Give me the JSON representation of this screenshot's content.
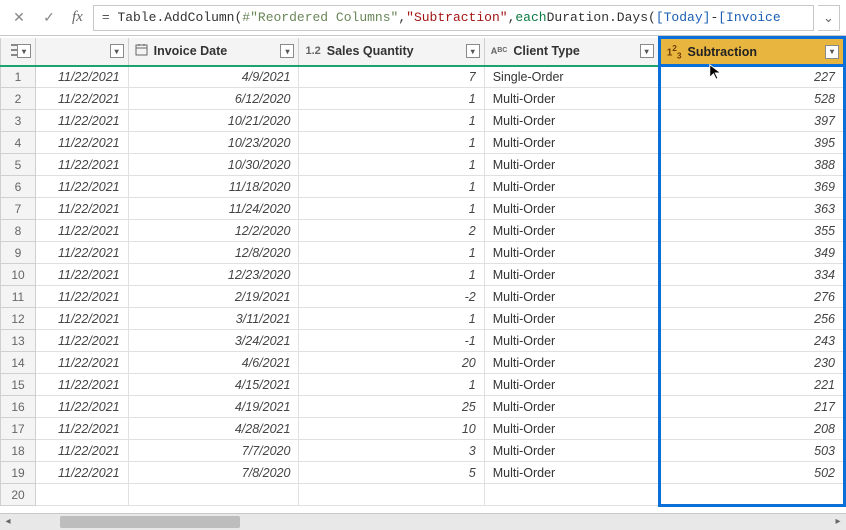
{
  "formula": {
    "eq": "=",
    "expr_parts": {
      "table_addcol": "Table.AddColumn",
      "openp": "(",
      "ref": "#\"Reordered Columns\"",
      "comma1": ", ",
      "str": "\"Subtraction\"",
      "comma2": ", ",
      "each": "each",
      "sp": " ",
      "fn2": "Duration.Days",
      "openp2": "(",
      "today": "[Today]",
      "minus": " - ",
      "inv": "[Invoice"
    }
  },
  "headers": {
    "today_filter": "▾",
    "invdate_label": "Invoice Date",
    "invdate_icon": "📅",
    "qty_icon": "1.2",
    "qty_label": "Sales Quantity",
    "client_icon_a": "A",
    "client_icon_b": "B",
    "client_icon_c": "C",
    "client_label": "Client Type",
    "sub_icon": "1²₃",
    "sub_label": "Subtraction"
  },
  "rows": [
    {
      "idx": "1",
      "today": "11/22/2021",
      "inv": "4/9/2021",
      "qty": "7",
      "client": "Single-Order",
      "sub": "227"
    },
    {
      "idx": "2",
      "today": "11/22/2021",
      "inv": "6/12/2020",
      "qty": "1",
      "client": "Multi-Order",
      "sub": "528"
    },
    {
      "idx": "3",
      "today": "11/22/2021",
      "inv": "10/21/2020",
      "qty": "1",
      "client": "Multi-Order",
      "sub": "397"
    },
    {
      "idx": "4",
      "today": "11/22/2021",
      "inv": "10/23/2020",
      "qty": "1",
      "client": "Multi-Order",
      "sub": "395"
    },
    {
      "idx": "5",
      "today": "11/22/2021",
      "inv": "10/30/2020",
      "qty": "1",
      "client": "Multi-Order",
      "sub": "388"
    },
    {
      "idx": "6",
      "today": "11/22/2021",
      "inv": "11/18/2020",
      "qty": "1",
      "client": "Multi-Order",
      "sub": "369"
    },
    {
      "idx": "7",
      "today": "11/22/2021",
      "inv": "11/24/2020",
      "qty": "1",
      "client": "Multi-Order",
      "sub": "363"
    },
    {
      "idx": "8",
      "today": "11/22/2021",
      "inv": "12/2/2020",
      "qty": "2",
      "client": "Multi-Order",
      "sub": "355"
    },
    {
      "idx": "9",
      "today": "11/22/2021",
      "inv": "12/8/2020",
      "qty": "1",
      "client": "Multi-Order",
      "sub": "349"
    },
    {
      "idx": "10",
      "today": "11/22/2021",
      "inv": "12/23/2020",
      "qty": "1",
      "client": "Multi-Order",
      "sub": "334"
    },
    {
      "idx": "11",
      "today": "11/22/2021",
      "inv": "2/19/2021",
      "qty": "-2",
      "client": "Multi-Order",
      "sub": "276"
    },
    {
      "idx": "12",
      "today": "11/22/2021",
      "inv": "3/11/2021",
      "qty": "1",
      "client": "Multi-Order",
      "sub": "256"
    },
    {
      "idx": "13",
      "today": "11/22/2021",
      "inv": "3/24/2021",
      "qty": "-1",
      "client": "Multi-Order",
      "sub": "243"
    },
    {
      "idx": "14",
      "today": "11/22/2021",
      "inv": "4/6/2021",
      "qty": "20",
      "client": "Multi-Order",
      "sub": "230"
    },
    {
      "idx": "15",
      "today": "11/22/2021",
      "inv": "4/15/2021",
      "qty": "1",
      "client": "Multi-Order",
      "sub": "221"
    },
    {
      "idx": "16",
      "today": "11/22/2021",
      "inv": "4/19/2021",
      "qty": "25",
      "client": "Multi-Order",
      "sub": "217"
    },
    {
      "idx": "17",
      "today": "11/22/2021",
      "inv": "4/28/2021",
      "qty": "10",
      "client": "Multi-Order",
      "sub": "208"
    },
    {
      "idx": "18",
      "today": "11/22/2021",
      "inv": "7/7/2020",
      "qty": "3",
      "client": "Multi-Order",
      "sub": "503"
    },
    {
      "idx": "19",
      "today": "11/22/2021",
      "inv": "7/8/2020",
      "qty": "5",
      "client": "Multi-Order",
      "sub": "502"
    },
    {
      "idx": "20",
      "today": "",
      "inv": "",
      "qty": "",
      "client": "",
      "sub": ""
    }
  ]
}
